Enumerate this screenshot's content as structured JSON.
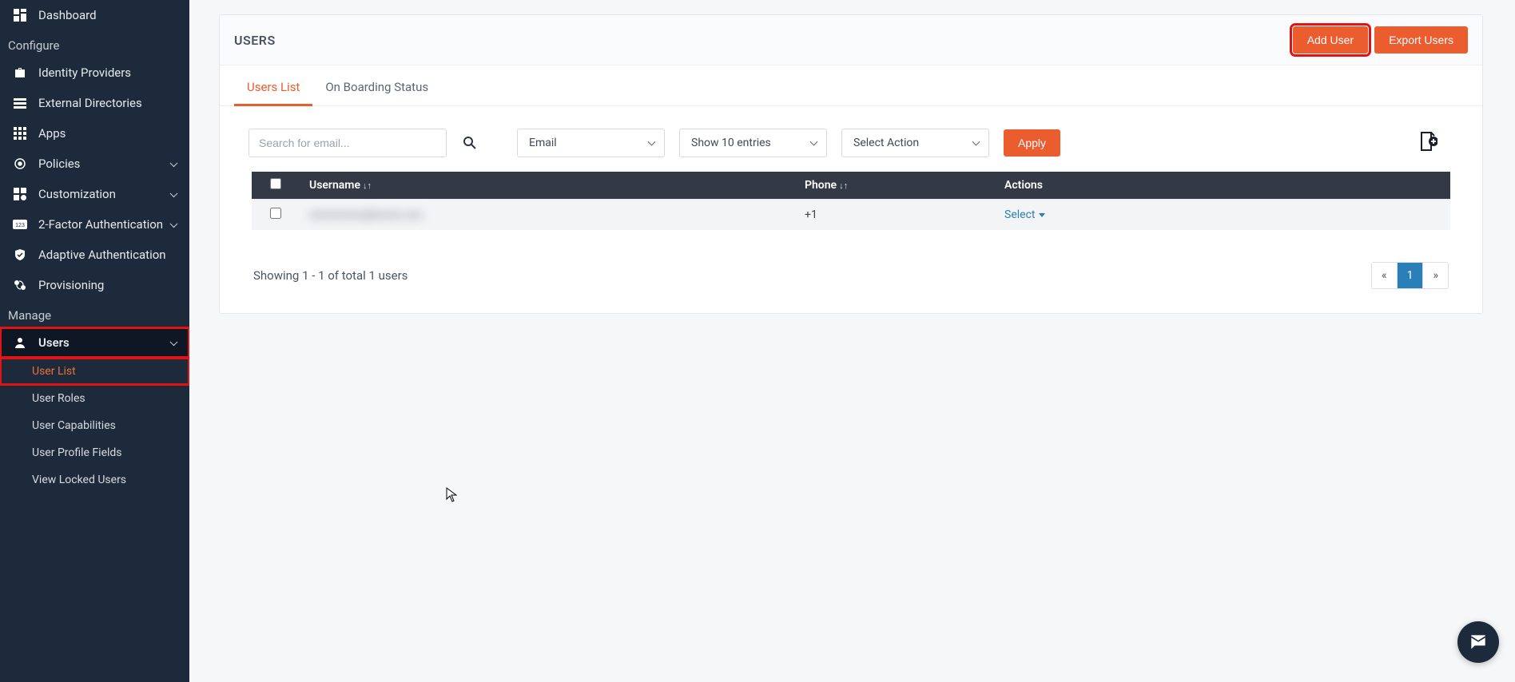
{
  "sidebar": {
    "dashboard": "Dashboard",
    "section_configure": "Configure",
    "identity_providers": "Identity Providers",
    "external_directories": "External Directories",
    "apps": "Apps",
    "policies": "Policies",
    "customization": "Customization",
    "two_factor": "2-Factor Authentication",
    "adaptive_auth": "Adaptive Authentication",
    "provisioning": "Provisioning",
    "section_manage": "Manage",
    "users": "Users",
    "sub_user_list": "User List",
    "sub_user_roles": "User Roles",
    "sub_user_capabilities": "User Capabilities",
    "sub_user_profile_fields": "User Profile Fields",
    "sub_view_locked_users": "View Locked Users"
  },
  "header": {
    "title": "USERS",
    "add_user": "Add User",
    "export_users": "Export Users"
  },
  "tabs": {
    "users_list": "Users List",
    "onboarding_status": "On Boarding Status"
  },
  "controls": {
    "search_placeholder": "Search for email...",
    "select_email": "Email",
    "select_entries": "Show 10 entries",
    "select_action": "Select Action",
    "apply": "Apply"
  },
  "columns": {
    "username": "Username",
    "phone": "Phone",
    "actions": "Actions"
  },
  "rows": [
    {
      "username": "xxxxxxxxxx@xxxxx.xxx",
      "phone": "+1",
      "action": "Select"
    }
  ],
  "footer": {
    "summary": "Showing 1 - 1 of total 1 users",
    "prev": "«",
    "page1": "1",
    "next": "»"
  }
}
